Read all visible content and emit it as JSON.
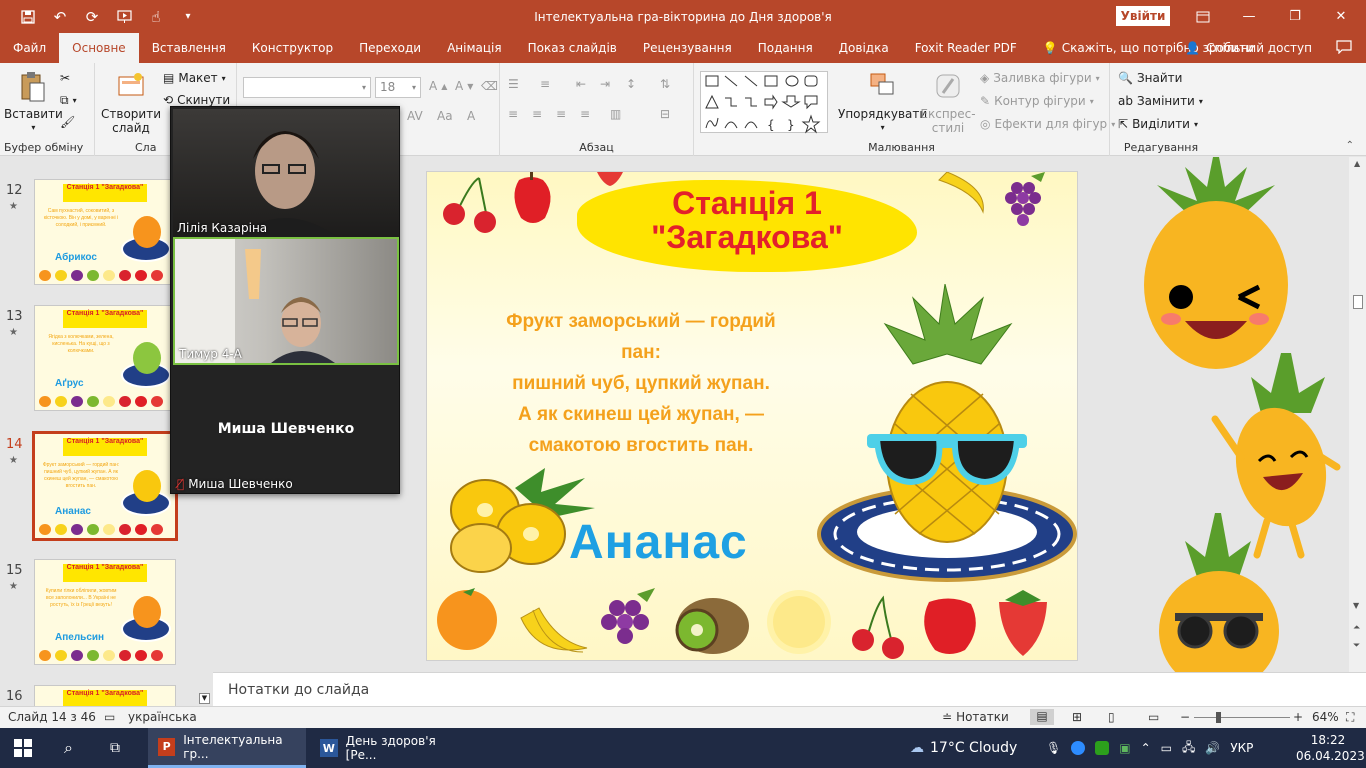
{
  "window": {
    "title": "Інтелектуальна гра-вікторина до Дня здоров'я",
    "signin": "Увійти"
  },
  "tabs": [
    {
      "label": "Файл"
    },
    {
      "label": "Основне",
      "active": true
    },
    {
      "label": "Вставлення"
    },
    {
      "label": "Конструктор"
    },
    {
      "label": "Переходи"
    },
    {
      "label": "Анімація"
    },
    {
      "label": "Показ слайдів"
    },
    {
      "label": "Рецензування"
    },
    {
      "label": "Подання"
    },
    {
      "label": "Довідка"
    },
    {
      "label": "Foxit Reader PDF"
    }
  ],
  "tellme": "Скажіть, що потрібно зробити",
  "share": "Спільний доступ",
  "ribbon": {
    "clipboard": {
      "paste": "Вставити",
      "group": "Буфер обміну"
    },
    "slides": {
      "new_slide": "Створити слайд",
      "layout": "Макет",
      "reset": "Скинути",
      "group": "Сла"
    },
    "font": {
      "size": "18"
    },
    "paragraph": {
      "group": "Абзац"
    },
    "drawing": {
      "arrange": "Упорядкувати",
      "quick_styles": "Експрес-стилі",
      "fill": "Заливка фігури",
      "outline": "Контур фігури",
      "effects": "Ефекти для фігур",
      "group": "Малювання"
    },
    "editing": {
      "find": "Знайти",
      "replace": "Замінити",
      "select": "Виділити",
      "group": "Редагування"
    }
  },
  "thumbnails": [
    {
      "num": "12",
      "title": "Станція 1 \"Загадкова\"",
      "text": "Сам пухнастий, соковитий, з кісточкою. Він у домі, у варенні і солодкий, і приємний.",
      "name": "Абрикос",
      "fruit_color": "#f7941d"
    },
    {
      "num": "13",
      "title": "Станція 1 \"Загадкова\"",
      "text": "Ягідка з колючками, зелена, кисленька. На кущі, що з колючками.",
      "name": "Аґрус",
      "fruit_color": "#8cc63f"
    },
    {
      "num": "14",
      "title": "Станція 1 \"Загадкова\"",
      "text": "Фрукт заморський — гордий пан: пишний чуб, цупкий жупан. А як скинеш цей жупан, — смакотою вгостить пан.",
      "name": "Ананас",
      "fruit_color": "#f9c80e",
      "selected": true
    },
    {
      "num": "15",
      "title": "Станція 1 \"Загадкова\"",
      "text": "Купили гілки обліпили, жовтим все заполонили... В Україні не ростуть, їх із Греції везуть!",
      "name": "Апельсин",
      "fruit_color": "#f7941d"
    },
    {
      "num": "16",
      "title": "Станція 1 \"Загадкова\"",
      "text": "",
      "name": "",
      "fruit_color": "#f9c80e"
    }
  ],
  "slide": {
    "title_line1": "Станція 1",
    "title_line2": "\"Загадкова\"",
    "riddle": [
      "Фрукт заморський — гордий",
      "пан:",
      "пишний чуб, цупкий жупан.",
      "А як скинеш цей жупан, —",
      "смакотою вгостить пан."
    ],
    "answer": "Ананас"
  },
  "notes": {
    "placeholder": "Нотатки до слайда"
  },
  "video": {
    "participants": [
      {
        "name": "Лілія Казаріна"
      },
      {
        "name": "Тимур 4-А"
      },
      {
        "name": "Миша Шевченко",
        "muted": true,
        "camera_off": true
      }
    ]
  },
  "status": {
    "slide_info": "Слайд 14 з 46",
    "language": "українська",
    "notes_btn": "Нотатки",
    "zoom": "64%"
  },
  "taskbar": {
    "apps": [
      {
        "label": "Інтелектуальна гр...",
        "active": true
      },
      {
        "label": "День здоров'я [Ре..."
      }
    ],
    "weather": "17°C  Cloudy",
    "lang": "УКР",
    "time": "18:22",
    "date": "06.04.2023"
  },
  "colors": {
    "accent": "#b7472a",
    "slide_title": "#e3202b",
    "riddle": "#f4a11c",
    "answer": "#1ea0e3"
  }
}
